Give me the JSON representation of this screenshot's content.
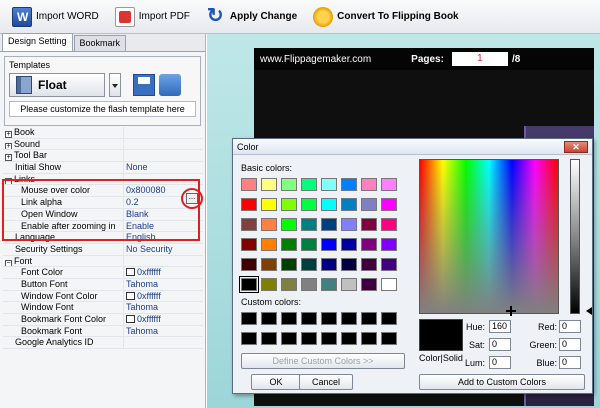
{
  "toolbar": {
    "import_word": "Import WORD",
    "import_pdf": "Import PDF",
    "apply_change": "Apply Change",
    "convert": "Convert To Flipping Book"
  },
  "tabs": [
    "Design Setting",
    "Bookmark"
  ],
  "templates": {
    "label": "Templates",
    "current": "Float",
    "customize": "Please customize the flash template here"
  },
  "properties": [
    {
      "name": "Book",
      "value": "",
      "type": "group"
    },
    {
      "name": "Sound",
      "value": "",
      "type": "group"
    },
    {
      "name": "Tool Bar",
      "value": "",
      "type": "group"
    },
    {
      "name": "Initial Show",
      "value": "None",
      "type": "item"
    },
    {
      "name": "Links",
      "value": "",
      "type": "group-open"
    },
    {
      "name": "Mouse over color",
      "value": "0x800080",
      "type": "sub"
    },
    {
      "name": "Link alpha",
      "value": "0.2",
      "type": "sub"
    },
    {
      "name": "Open Window",
      "value": "Blank",
      "type": "sub"
    },
    {
      "name": "Enable after zooming in",
      "value": "Enable",
      "type": "sub"
    },
    {
      "name": "Language",
      "value": "English",
      "type": "item"
    },
    {
      "name": "Security Settings",
      "value": "No Security",
      "type": "item"
    },
    {
      "name": "Font",
      "value": "",
      "type": "group-open"
    },
    {
      "name": "Font Color",
      "value": "0xffffff",
      "type": "sub-swatch"
    },
    {
      "name": "Button Font",
      "value": "Tahoma",
      "type": "sub"
    },
    {
      "name": "Window Font Color",
      "value": "0xffffff",
      "type": "sub-swatch"
    },
    {
      "name": "Window Font",
      "value": "Tahoma",
      "type": "sub"
    },
    {
      "name": "Bookmark Font Color",
      "value": "0xffffff",
      "type": "sub-swatch"
    },
    {
      "name": "Bookmark Font",
      "value": "Tahoma",
      "type": "sub"
    },
    {
      "name": "Google Analytics ID",
      "value": "",
      "type": "item"
    }
  ],
  "viewer": {
    "site": "www.Flippagemaker.com",
    "pages_label": "Pages:",
    "current_page": "1",
    "total_pages": "/8"
  },
  "color_dialog": {
    "title": "Color",
    "basic_label": "Basic colors:",
    "custom_label": "Custom colors:",
    "define_custom": "Define Custom Colors >>",
    "ok": "OK",
    "cancel": "Cancel",
    "color_solid": "Color|Solid",
    "add_custom": "Add to Custom Colors",
    "hue_label": "Hue:",
    "hue": "160",
    "sat_label": "Sat:",
    "sat": "0",
    "lum_label": "Lum:",
    "lum": "0",
    "red_label": "Red:",
    "red": "0",
    "green_label": "Green:",
    "green": "0",
    "blue_label": "Blue:",
    "blue": "0",
    "basic_colors": [
      "#ff8080",
      "#ffff80",
      "#80ff80",
      "#00ff80",
      "#80ffff",
      "#0080ff",
      "#ff80c0",
      "#ff80ff",
      "#ff0000",
      "#ffff00",
      "#80ff00",
      "#00ff40",
      "#00ffff",
      "#0080c0",
      "#8080c0",
      "#ff00ff",
      "#804040",
      "#ff8040",
      "#00ff00",
      "#008080",
      "#004080",
      "#8080ff",
      "#800040",
      "#ff0080",
      "#800000",
      "#ff8000",
      "#008000",
      "#008040",
      "#0000ff",
      "#0000a0",
      "#800080",
      "#8000ff",
      "#400000",
      "#804000",
      "#004000",
      "#004040",
      "#000080",
      "#000040",
      "#400040",
      "#400080",
      "#000000",
      "#808000",
      "#808040",
      "#808080",
      "#408080",
      "#c0c0c0",
      "#400040",
      "#ffffff"
    ],
    "selected_basic": 40,
    "custom_count": 16
  }
}
